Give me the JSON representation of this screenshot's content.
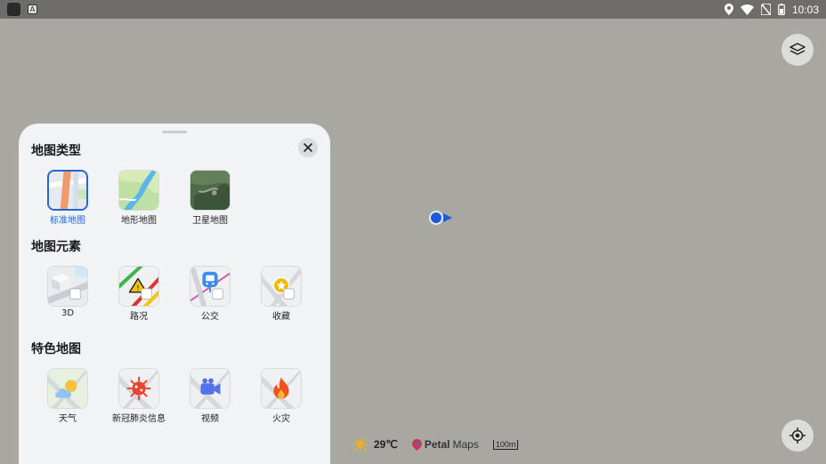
{
  "status_bar": {
    "time": "10:03",
    "app_icons": [
      "app-icon",
      "a-icon"
    ],
    "status_icons": [
      "location-icon",
      "wifi-icon",
      "no-sim-icon",
      "battery-icon"
    ]
  },
  "map": {
    "weather": {
      "icon": "sun-icon",
      "temperature": "29℃"
    },
    "brand": {
      "name_bold": "Petal",
      "name_light": "Maps"
    },
    "scale": "100m"
  },
  "layers_panel": {
    "sections": [
      {
        "title": "地图类型",
        "items": [
          {
            "label": "标准地图",
            "icon": "standard-map-icon",
            "selected": true
          },
          {
            "label": "地形地图",
            "icon": "terrain-map-icon",
            "selected": false
          },
          {
            "label": "卫星地图",
            "icon": "satellite-map-icon",
            "selected": false
          }
        ]
      },
      {
        "title": "地图元素",
        "items": [
          {
            "label": "3D",
            "icon": "3d-buildings-icon"
          },
          {
            "label": "路况",
            "icon": "traffic-icon"
          },
          {
            "label": "公交",
            "icon": "transit-icon"
          },
          {
            "label": "收藏",
            "icon": "favorites-icon"
          }
        ]
      },
      {
        "title": "特色地图",
        "items": [
          {
            "label": "天气",
            "icon": "weather-icon"
          },
          {
            "label": "新冠肺炎信息",
            "icon": "covid-icon"
          },
          {
            "label": "视频",
            "icon": "video-icon"
          },
          {
            "label": "火灾",
            "icon": "fire-icon"
          }
        ]
      }
    ]
  },
  "colors": {
    "accent": "#2565d9",
    "map_bg": "#a8a7a2",
    "panel_bg": "#f1f3f5"
  }
}
